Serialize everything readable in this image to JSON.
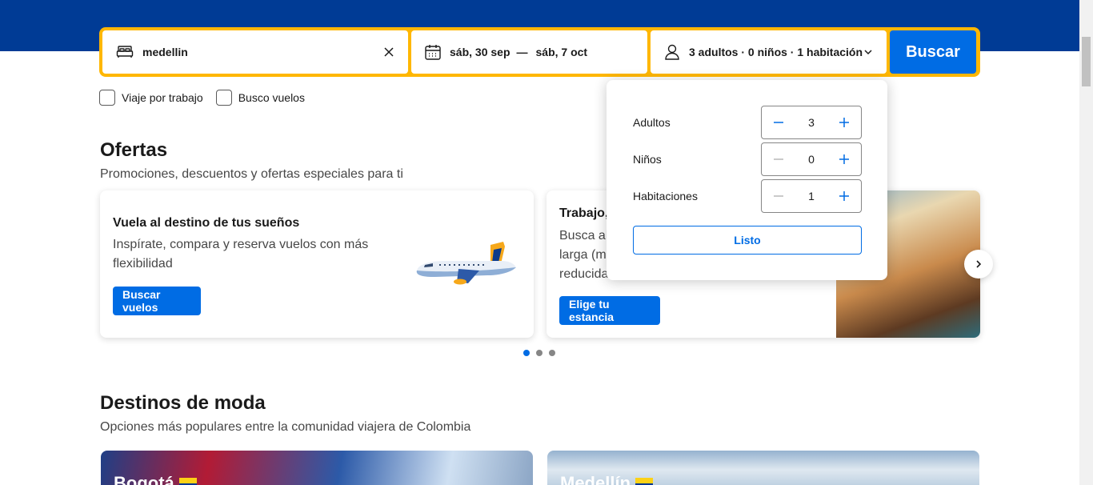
{
  "search": {
    "destination": "medellin",
    "check_in": "sáb, 30 sep",
    "date_separator": "—",
    "check_out": "sáb, 7 oct",
    "occupancy": "3 adultos · 0 niños · 1 habitación",
    "submit_label": "Buscar"
  },
  "filters": {
    "business_trip": "Viaje por trabajo",
    "flights": "Busco vuelos"
  },
  "offers": {
    "title": "Ofertas",
    "subtitle": "Promociones, descuentos y ofertas especiales para ti",
    "cards": [
      {
        "title": "Vuela al destino de tus sueños",
        "text_line1": "Inspírate, compara y reserva vuelos con más",
        "text_line2": "flexibilidad",
        "cta": "Buscar vuelos"
      },
      {
        "title": "Trabajo,",
        "text_line1": "Busca alo",
        "text_line2": "larga (mu",
        "text_line3": "reducida,",
        "cta": "Elige tu estancia"
      }
    ]
  },
  "trending": {
    "title": "Destinos de moda",
    "subtitle": "Opciones más populares entre la comunidad viajera de Colombia",
    "destinations": [
      "Bogotá",
      "Medellín"
    ]
  },
  "occupancy_popup": {
    "rows": [
      {
        "label": "Adultos",
        "value": "3",
        "minus_enabled": true
      },
      {
        "label": "Niños",
        "value": "0",
        "minus_enabled": false
      },
      {
        "label": "Habitaciones",
        "value": "1",
        "minus_enabled": false
      }
    ],
    "done_label": "Listo"
  },
  "carousel": {
    "pages": 3,
    "active": 1
  },
  "colors": {
    "brand": "#003b95",
    "accent": "#006ce4",
    "search_border": "#ffb700"
  }
}
